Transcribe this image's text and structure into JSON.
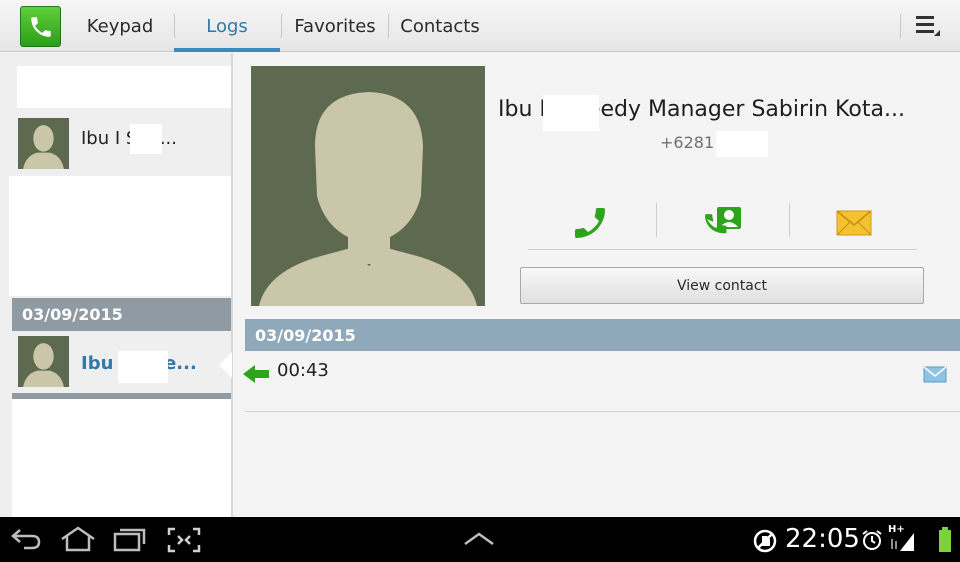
{
  "tabs": {
    "keypad": "Keypad",
    "logs": "Logs",
    "favorites": "Favorites",
    "contacts": "Contacts"
  },
  "log_list": {
    "items": [
      {
        "name": "Ibu I      Spe..."
      },
      {
        "name": "Ibu F      Spe..."
      }
    ],
    "date_header": "03/09/2015"
  },
  "detail": {
    "contact_name": "Ibu F          Speedy Manager Sabirin Kota...",
    "contact_number": "+62811         34",
    "view_contact_label": "View contact",
    "date_header": "03/09/2015",
    "call_duration": "00:43"
  },
  "status_bar": {
    "time": "22:05",
    "network": "H+"
  },
  "colors": {
    "accent": "#3a8cc0",
    "call_green": "#2ea31c",
    "email_yellow": "#f2c230"
  }
}
